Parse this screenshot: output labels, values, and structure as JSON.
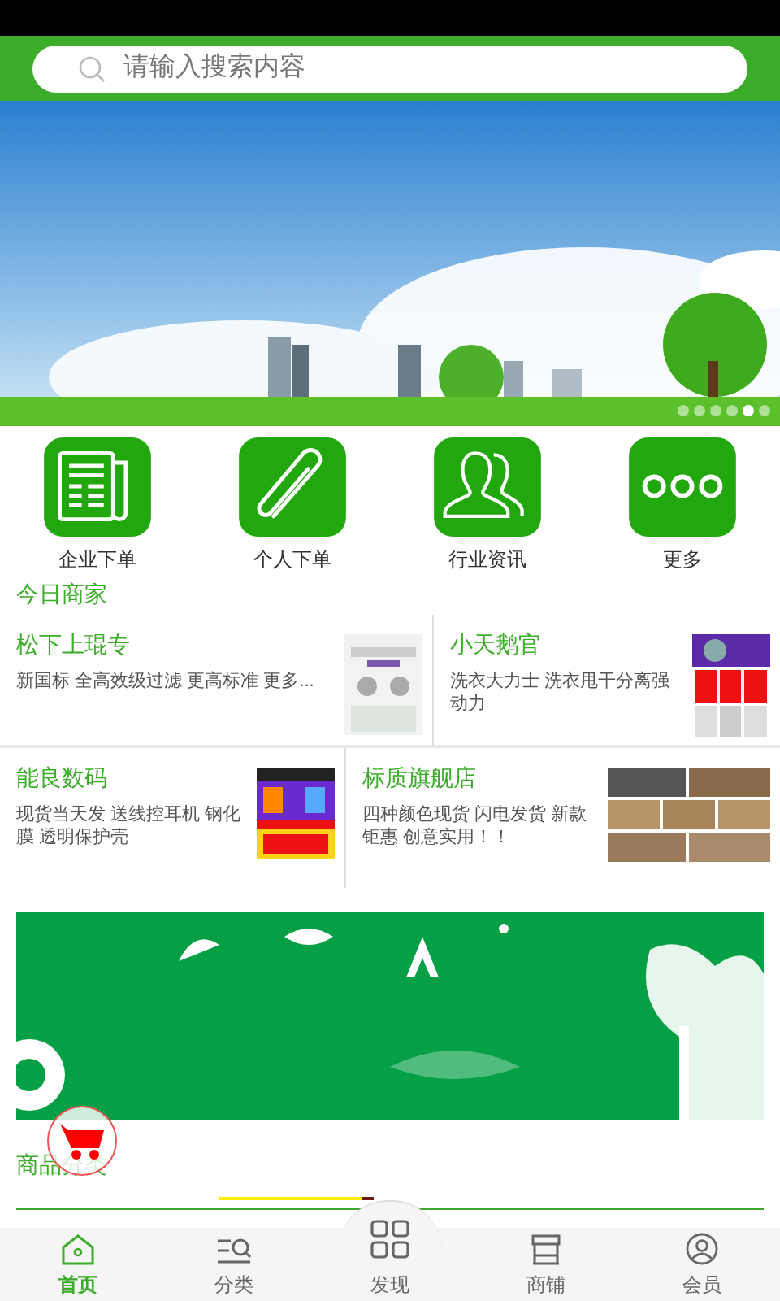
{
  "search": {
    "placeholder": "请输入搜索内容"
  },
  "banner": {
    "kind": "picture",
    "dots": [
      {
        "selected": false
      },
      {
        "selected": false
      },
      {
        "selected": false
      },
      {
        "selected": false
      },
      {
        "selected": true
      },
      {
        "selected": false
      }
    ]
  },
  "shortcuts": [
    {
      "label": "企业下单"
    },
    {
      "label": "个人下单"
    },
    {
      "label": "行业资讯"
    },
    {
      "label": "更多"
    }
  ],
  "merchants_title": "今日商家",
  "merchants": [
    {
      "name": "松下上琨专",
      "desc": "新国标 全高效级过滤 更高标准 更多..."
    },
    {
      "name": "小天鹅官",
      "desc": "洗衣大力士 洗衣甩干分离强动力"
    },
    {
      "name": "能良数码",
      "desc": "现货当天发 送线控耳机 钢化膜 透明保护壳"
    },
    {
      "name": "标质旗舰店",
      "desc": "四种颜色现货 闪电发货 新款钜惠 创意实用！！"
    }
  ],
  "categories_title": "商品分类",
  "nav": [
    {
      "label": "首页",
      "selected": true
    },
    {
      "label": "分类",
      "selected": false
    },
    {
      "label": "发现",
      "selected": false
    },
    {
      "label": "商铺",
      "selected": false
    },
    {
      "label": "会员",
      "selected": false
    }
  ]
}
